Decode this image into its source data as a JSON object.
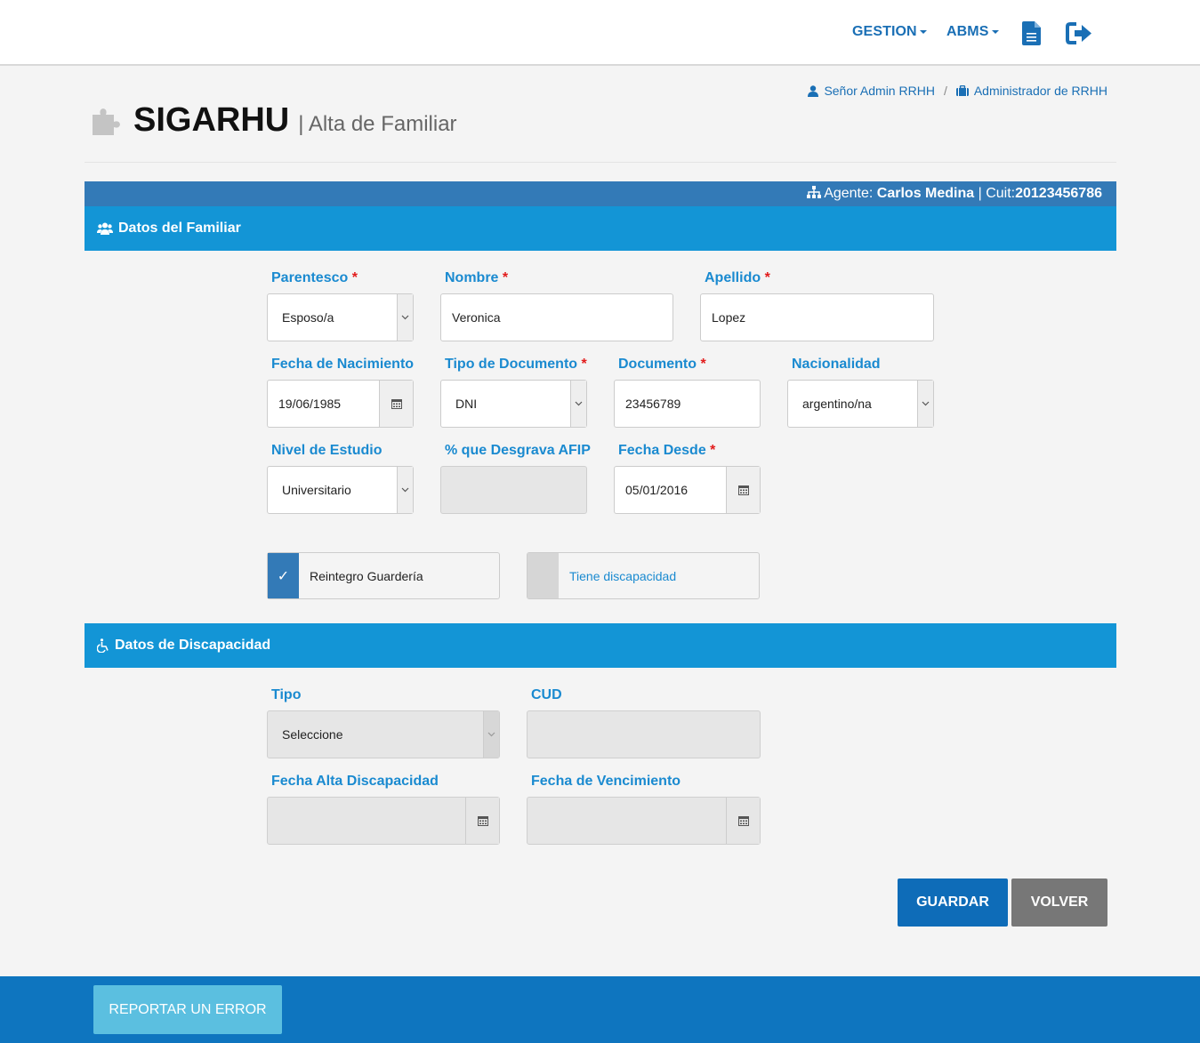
{
  "nav": {
    "gestion": "GESTION",
    "abms": "ABMS",
    "doc_icon": "document-icon",
    "logout_icon": "sign-out-icon"
  },
  "header": {
    "user_name": "Señor Admin RRHH",
    "separator": "/",
    "role": "Administrador de RRHH",
    "app_title": "SIGARHU",
    "page_subtitle": "| Alta de Familiar"
  },
  "agent_bar": {
    "label": "Agente:",
    "name": "Carlos Medina",
    "cuit_label": "| Cuit:",
    "cuit": "20123456786"
  },
  "familiar_section": {
    "title": "Datos del Familiar",
    "parentesco": {
      "label": "Parentesco",
      "value": "Esposo/a"
    },
    "nombre": {
      "label": "Nombre",
      "value": "Veronica"
    },
    "apellido": {
      "label": "Apellido",
      "value": "Lopez"
    },
    "fecha_nacimiento": {
      "label": "Fecha de Nacimiento",
      "value": "19/06/1985"
    },
    "tipo_documento": {
      "label": "Tipo de Documento",
      "value": "DNI"
    },
    "documento": {
      "label": "Documento",
      "value": "23456789"
    },
    "nacionalidad": {
      "label": "Nacionalidad",
      "value": "argentino/na"
    },
    "nivel_estudio": {
      "label": "Nivel de Estudio",
      "value": "Universitario"
    },
    "desgrava": {
      "label": "% que Desgrava AFIP",
      "value": ""
    },
    "fecha_desde": {
      "label": "Fecha Desde",
      "value": "05/01/2016"
    },
    "reintegro": {
      "label": "Reintegro Guardería",
      "checked": true
    },
    "discapacidad": {
      "label": "Tiene discapacidad",
      "checked": false
    },
    "required_mark": "*"
  },
  "discapacidad_section": {
    "title": "Datos de Discapacidad",
    "tipo": {
      "label": "Tipo",
      "value": "Seleccione"
    },
    "cud": {
      "label": "CUD",
      "value": ""
    },
    "fecha_alta": {
      "label": "Fecha Alta Discapacidad",
      "value": ""
    },
    "fecha_venc": {
      "label": "Fecha de Vencimiento",
      "value": ""
    }
  },
  "actions": {
    "guardar": "GUARDAR",
    "volver": "VOLVER"
  },
  "footer": {
    "report": "REPORTAR UN ERROR"
  },
  "colors": {
    "primary": "#1a6fb5",
    "section": "#1395d6",
    "agent_bar": "#337ab7",
    "guardar": "#0e6cb8",
    "volver": "#777777",
    "footer": "#0e75bf",
    "report": "#5bbfe0"
  }
}
